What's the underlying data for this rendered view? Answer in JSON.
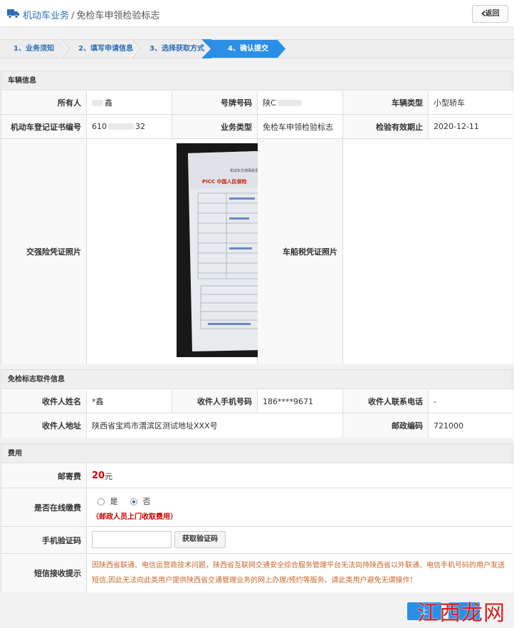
{
  "header": {
    "crumb_root": "机动车业务",
    "crumb_sep": "/",
    "crumb_current": "免检车申领检验标志",
    "back_label": "返回"
  },
  "steps": [
    {
      "label": "1、业务须知"
    },
    {
      "label": "2、填写申请信息"
    },
    {
      "label": "3、选择获取方式"
    },
    {
      "label": "4、确认提交"
    }
  ],
  "vehicle": {
    "section_title": "车辆信息",
    "owner_label": "所有人",
    "owner_value": "鑫",
    "plate_label": "号牌号码",
    "plate_value": "陕C",
    "type_label": "车辆类型",
    "type_value": "小型轿车",
    "cert_label": "机动车登记证书编号",
    "cert_prefix": "610",
    "cert_suffix": "32",
    "biz_label": "业务类型",
    "biz_value": "免检车申领检验标志",
    "expire_label": "检验有效期止",
    "expire_value": "2020-12-11",
    "insurance_photo_label": "交强险凭证照片",
    "tax_photo_label": "车船税凭证照片",
    "doc_title": "机动车交通事故责任强制保险单（正本）",
    "doc_company": "PICC 中国人民保险"
  },
  "receive": {
    "section_title": "免检标志取件信息",
    "name_label": "收件人姓名",
    "name_value": "*鑫",
    "phone_label": "收件人手机号码",
    "phone_value": "186****9671",
    "contact_label": "收件人联系电话",
    "contact_value": "-",
    "address_label": "收件人地址",
    "address_value": "陕西省宝鸡市渭滨区测试地址XXX号",
    "zip_label": "邮政编码",
    "zip_value": "721000"
  },
  "fees": {
    "section_title": "费用",
    "postage_label": "邮寄费",
    "postage_amount": "20",
    "postage_unit": "元",
    "online_label": "是否在线缴费",
    "option_yes": "是",
    "option_no": "否",
    "online_selected": "否",
    "online_note": "（邮政人员上门收取费用）",
    "sms_label": "手机验证码",
    "sms_input_value": "",
    "sms_button": "获取验证码",
    "notice_label": "短信接收提示",
    "notice_text": "因陕西省联通、电信运营商技术问题，陕西省互联网交通安全综合服务管理平台无法向持陕西省以外联通、电信手机号码的用户发送短信,因此无法向此类用户提供陕西省交通管理业务的网上办理/预约等服务。请此类用户避免无谓操作！"
  },
  "footer": {
    "submit_label": "上",
    "watermark": "江西龙网"
  },
  "colors": {
    "accent": "#2b8fe6",
    "link": "#2a6cb8",
    "alert": "#cc0000",
    "notice": "#c8672b"
  }
}
